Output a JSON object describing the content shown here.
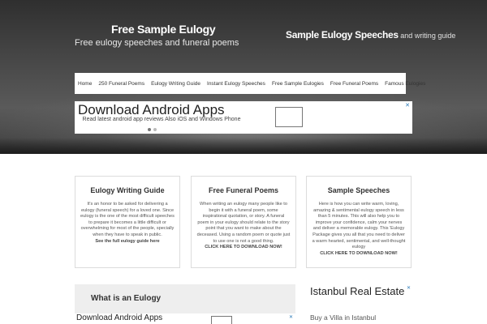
{
  "header": {
    "site_title": "Free Sample Eulogy",
    "tagline": "Free eulogy speeches and funeral poems",
    "right_title": "Sample Eulogy Speeches",
    "right_sub": " and writing guide"
  },
  "nav": {
    "items": [
      "Home",
      "250 Funeral Poems",
      "Eulogy Writing Guide",
      "Instant Eulogy Speeches",
      "Free Sample Eulogies",
      "Free Funeral Poems",
      "Famous Eulogies"
    ]
  },
  "ad_top": {
    "title": "Download Android Apps",
    "description": "Read latest android app reviews Also iOS and Windows Phone",
    "close": "✕"
  },
  "cards": [
    {
      "title": "Eulogy Writing Guide",
      "body": "It's an honor to be asked for delivering a eulogy (funeral speech) for a loved one. Since eulogy is the one of the most difficult speeches to prepare it becomes a little difficult or overwhelming for most of the people, specially when they have to speak in public.",
      "link": "See the full eulogy guide here"
    },
    {
      "title": "Free Funeral Poems",
      "body": "When writing an eulogy many people like to begin it with a funeral poem, some inspirational quotation, or story. A funeral poem in your eulogy should relate to the story point that you want to make about the deceased. Using a random poem or quote just to use one is not a good thing.",
      "link": "CLICK HERE TO DOWNLOAD NOW!"
    },
    {
      "title": "Sample Speeches",
      "body": "Here is how you can write warm, loving, amazing & sentimental eulogy speech in less than 5 minutes. This will also help you to improve your confidence, calm your nerves and deliver a memorable eulogy. This 'Eulogy Package gives you all that you need to deliver a warm hearted, sentimental, and well-thought eulogy",
      "link": "CLICK HERE TO DOWNLOAD NOW!"
    }
  ],
  "section": {
    "title": "What is an Eulogy"
  },
  "ad_bottom": {
    "title": "Download Android Apps",
    "close": "✕"
  },
  "ad_side": {
    "title": "Istanbul Real Estate",
    "description": "Buy a Villa in Istanbul",
    "close": "✕"
  }
}
